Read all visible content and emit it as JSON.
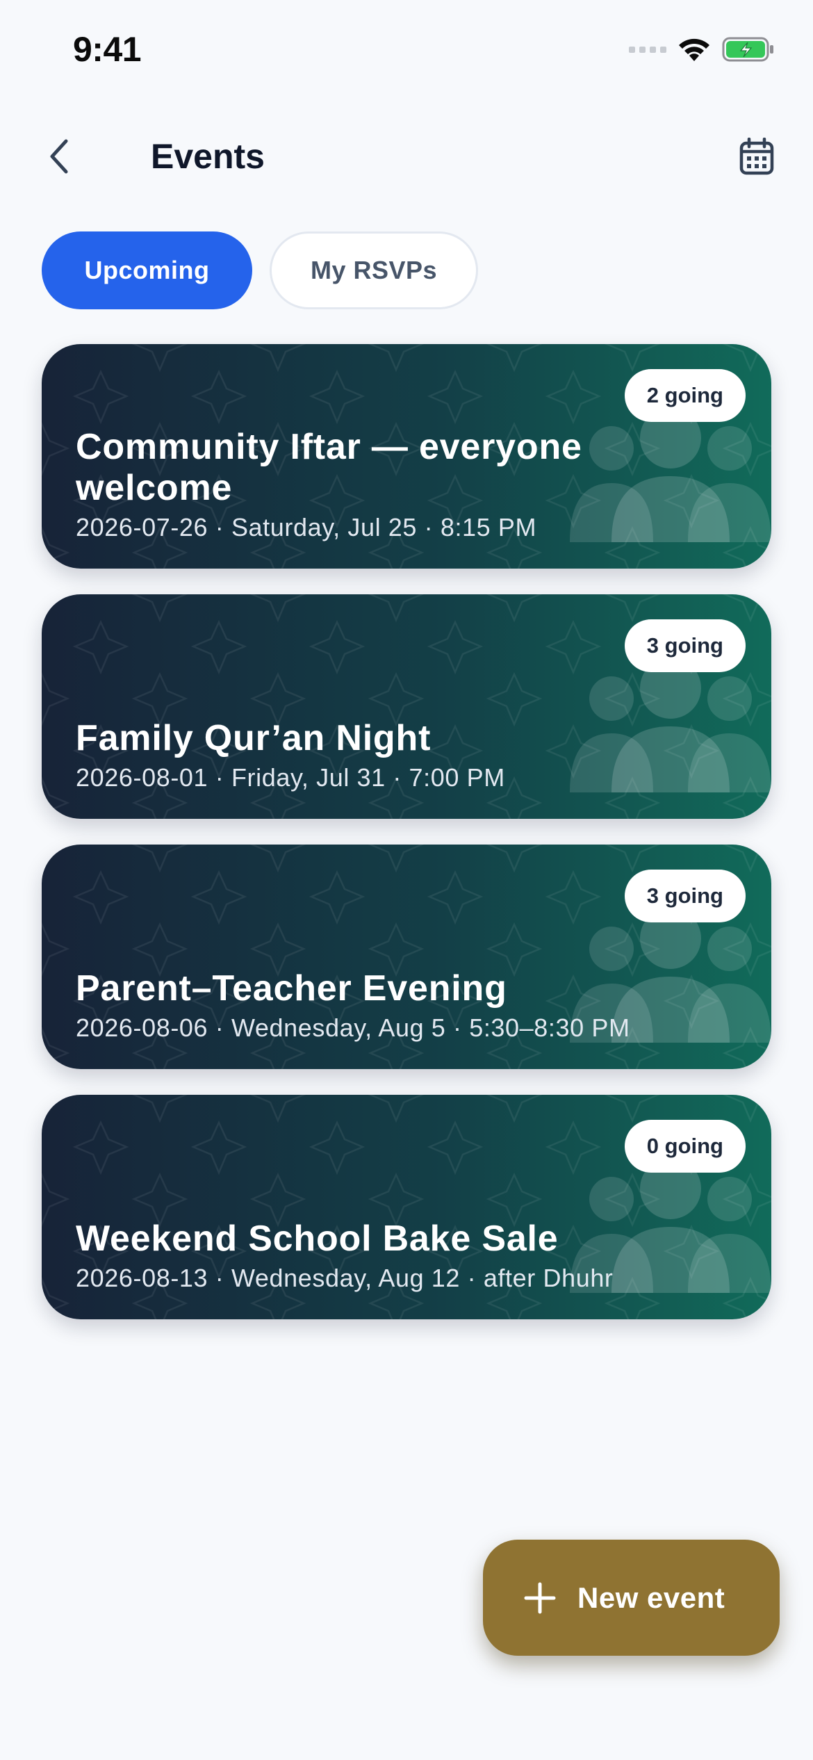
{
  "status_bar": {
    "time": "9:41"
  },
  "header": {
    "title": "Events"
  },
  "tabs": [
    {
      "label": "Upcoming",
      "active": true
    },
    {
      "label": "My RSVPs",
      "active": false
    }
  ],
  "events": [
    {
      "title": "Community Iftar — everyone welcome",
      "meta": "2026-07-26 · Saturday, Jul 25 · 8:15 PM",
      "going": "2 going"
    },
    {
      "title": "Family Qur’an Night",
      "meta": "2026-08-01 · Friday, Jul 31 · 7:00 PM",
      "going": "3 going"
    },
    {
      "title": "Parent–Teacher Evening",
      "meta": "2026-08-06 · Wednesday, Aug 5 · 5:30–8:30 PM",
      "going": "3 going"
    },
    {
      "title": "Weekend School Bake Sale",
      "meta": "2026-08-13 · Wednesday, Aug 12 · after Dhuhr",
      "going": "0 going"
    }
  ],
  "fab": {
    "label": "New event"
  },
  "colors": {
    "primary": "#2563eb",
    "fab": "#8f7332",
    "card_gradient_start": "#172338",
    "card_gradient_end": "#116b5a",
    "battery": "#34c759"
  },
  "icons": [
    "chevron-left-icon",
    "calendar-icon",
    "plus-icon",
    "wifi-icon",
    "battery-charging-icon",
    "people-icon",
    "star-pattern"
  ]
}
